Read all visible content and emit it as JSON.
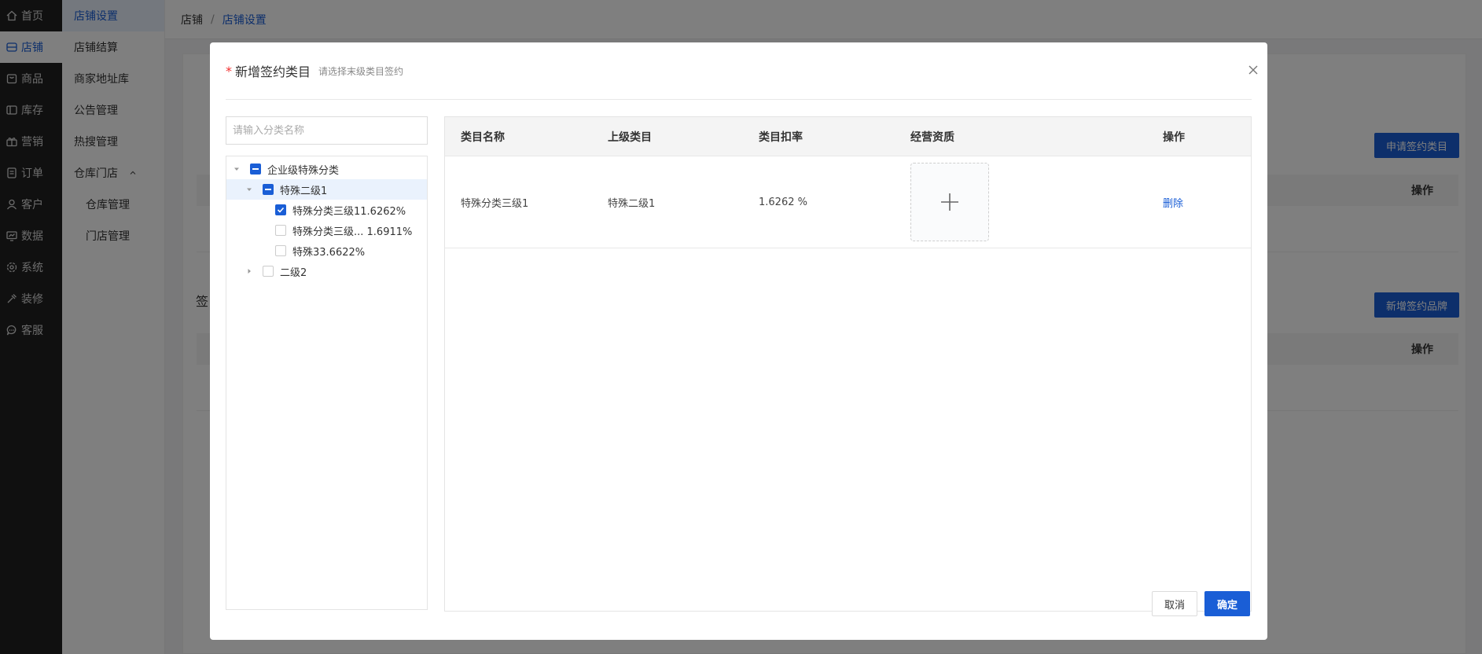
{
  "nav_primary": [
    {
      "label": "首页",
      "icon": "home-icon"
    },
    {
      "label": "店铺",
      "icon": "store-icon",
      "active": true
    },
    {
      "label": "商品",
      "icon": "goods-icon"
    },
    {
      "label": "库存",
      "icon": "inventory-icon"
    },
    {
      "label": "营销",
      "icon": "marketing-icon"
    },
    {
      "label": "订单",
      "icon": "order-icon"
    },
    {
      "label": "客户",
      "icon": "customer-icon"
    },
    {
      "label": "数据",
      "icon": "data-icon"
    },
    {
      "label": "系统",
      "icon": "system-icon"
    },
    {
      "label": "装修",
      "icon": "decoration-icon"
    },
    {
      "label": "客服",
      "icon": "service-icon"
    }
  ],
  "nav_secondary": {
    "shop_settings": "店铺设置",
    "shop_settlement": "店铺结算",
    "address_book": "商家地址库",
    "announcements": "公告管理",
    "hot_search": "热搜管理",
    "warehouse_store": "仓库门店",
    "warehouse_manage": "仓库管理",
    "store_manage": "门店管理"
  },
  "breadcrumb": {
    "root": "店铺",
    "separator": "/",
    "current": "店铺设置"
  },
  "page": {
    "apply_category_button": "申请签约类目",
    "add_brand_button": "新增签约品牌",
    "table_action_header": "操作",
    "section_label_signed": "签"
  },
  "modal": {
    "required_mark": "*",
    "title": "新增签约类目",
    "hint": "请选择末级类目签约",
    "search_placeholder": "请输入分类名称",
    "tree": [
      {
        "label": "企业级特殊分类",
        "level": 0,
        "arrow": "expanded",
        "check": "half"
      },
      {
        "label": "特殊二级1",
        "level": 1,
        "arrow": "expanded",
        "check": "half",
        "highlight": true
      },
      {
        "label": "特殊分类三级11.6262%",
        "level": 2,
        "arrow": "none",
        "check": "on"
      },
      {
        "label": "特殊分类三级... 1.6911%",
        "level": 2,
        "arrow": "none",
        "check": "off"
      },
      {
        "label": "特殊33.6622%",
        "level": 2,
        "arrow": "none",
        "check": "off"
      },
      {
        "label": "二级2",
        "level": 1,
        "arrow": "collapsed",
        "check": "off"
      }
    ],
    "table": {
      "headers": {
        "name": "类目名称",
        "parent": "上级类目",
        "rate": "类目扣率",
        "qualification": "经营资质",
        "action": "操作"
      },
      "rows": [
        {
          "name": "特殊分类三级1",
          "parent": "特殊二级1",
          "rate": "1.6262 %",
          "action": "删除"
        }
      ]
    },
    "cancel_label": "取消",
    "confirm_label": "确定"
  },
  "colors": {
    "primary": "#1a5ed6",
    "nav_dark": "#202020",
    "required": "#f23030"
  }
}
